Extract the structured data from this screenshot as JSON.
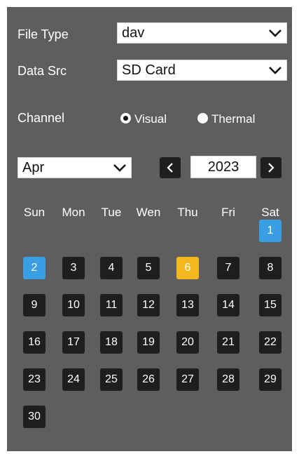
{
  "form": {
    "file_type_label": "File Type",
    "file_type_value": "dav",
    "data_src_label": "Data Src",
    "data_src_value": "SD Card",
    "channel_label": "Channel",
    "channel_options": [
      {
        "label": "Visual",
        "selected": true
      },
      {
        "label": "Thermal",
        "selected": false
      }
    ]
  },
  "calendar": {
    "month": "Apr",
    "year": "2023",
    "prev_icon": "chevron-left-icon",
    "next_icon": "chevron-right-icon",
    "weekdays": [
      "Sun",
      "Mon",
      "Tue",
      "Wen",
      "Thu",
      "Fri",
      "Sat"
    ],
    "first_weekday_index": 6,
    "days": [
      "1",
      "2",
      "3",
      "4",
      "5",
      "6",
      "7",
      "8",
      "9",
      "10",
      "11",
      "12",
      "13",
      "14",
      "15",
      "16",
      "17",
      "18",
      "19",
      "20",
      "21",
      "22",
      "23",
      "24",
      "25",
      "26",
      "27",
      "28",
      "29",
      "30"
    ],
    "selected_day": "2",
    "highlight_days": [
      "1",
      "2"
    ],
    "today": "6"
  },
  "colors": {
    "panel_bg": "#5e5e5e",
    "day_bg": "#1e1e1e",
    "highlight": "#3a9ee4",
    "today": "#f2b81d"
  }
}
